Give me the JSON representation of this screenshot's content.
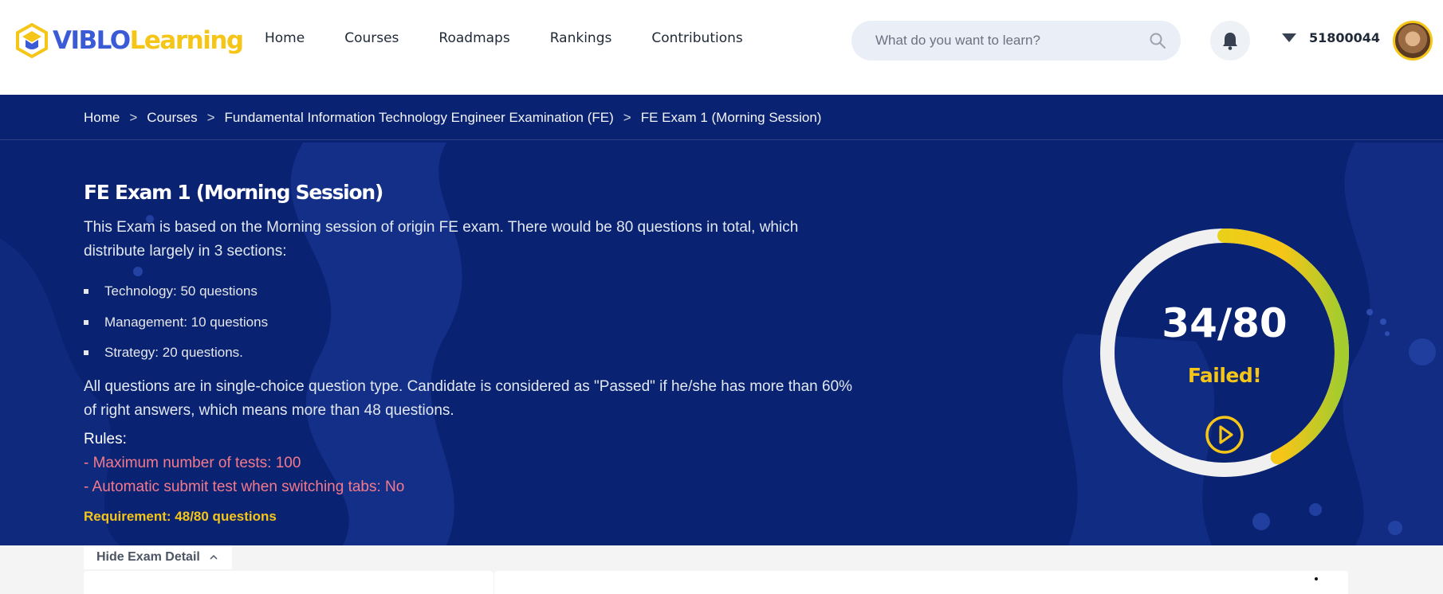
{
  "header": {
    "logo": {
      "part1": "VIBLO",
      "part2": "Learning"
    },
    "nav": [
      "Home",
      "Courses",
      "Roadmaps",
      "Rankings",
      "Contributions"
    ],
    "search": {
      "placeholder": "What do you want to learn?",
      "value": ""
    },
    "user": {
      "name": "51800044"
    }
  },
  "breadcrumb": [
    "Home",
    "Courses",
    "Fundamental Information Technology Engineer Examination (FE)",
    "FE Exam 1 (Morning Session)"
  ],
  "breadcrumb_separator": ">",
  "exam": {
    "title": "FE Exam 1 (Morning Session)",
    "description": "This Exam is based on the Morning session of origin FE exam. There would be 80 questions in total, which distribute largely in 3 sections:",
    "sections": [
      "Technology: 50 questions",
      "Management: 10 questions",
      "Strategy: 20 questions."
    ],
    "criteria": "All questions are in single-choice question type. Candidate is considered as \"Passed\" if he/she has more than 60% of right answers, which means more than 48 questions.",
    "rules_label": "Rules:",
    "rules": [
      "- Maximum number of tests: 100",
      "- Automatic submit test when switching tabs: No"
    ],
    "requirement": "Requirement: 48/80 questions"
  },
  "score": {
    "text": "34/80",
    "correct": 34,
    "total": 80,
    "status": "Failed!"
  },
  "toggle": {
    "label": "Hide Exam Detail"
  },
  "colors": {
    "hero_bg": "#0a2272",
    "accent_yellow": "#f5c518",
    "rule_red": "#f47a8c",
    "progress_green": "#9acd32",
    "brand_blue": "#3b5bd6"
  }
}
